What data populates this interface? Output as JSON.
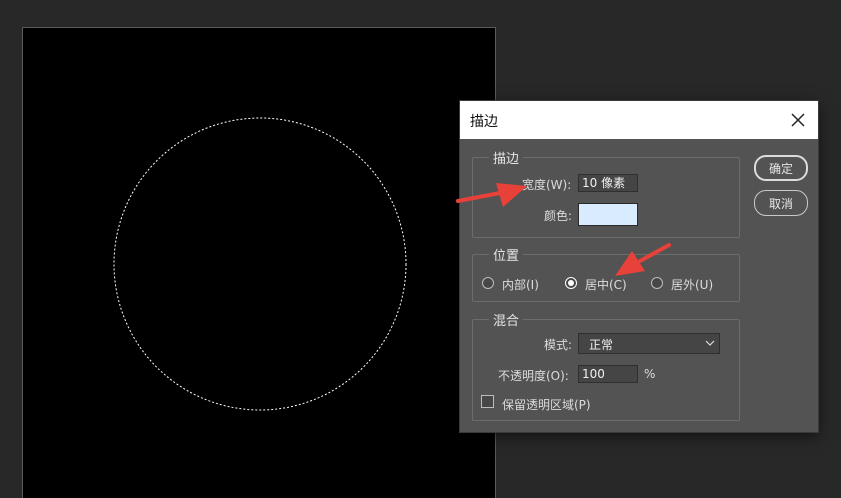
{
  "dialog": {
    "title": "描边",
    "stroke_group": {
      "legend": "描边",
      "width_label": "宽度(W):",
      "width_value": "10 像素",
      "color_label": "颜色:",
      "color_value": "#d8ebff"
    },
    "position_group": {
      "legend": "位置",
      "options": [
        {
          "label": "内部(I)",
          "selected": false
        },
        {
          "label": "居中(C)",
          "selected": true
        },
        {
          "label": "居外(U)",
          "selected": false
        }
      ]
    },
    "blend_group": {
      "legend": "混合",
      "mode_label": "模式:",
      "mode_value": "正常",
      "opacity_label": "不透明度(O):",
      "opacity_value": "100",
      "opacity_unit": "%",
      "preserve_label": "保留透明区域(P)",
      "preserve_checked": false
    },
    "buttons": {
      "ok": "确定",
      "cancel": "取消"
    }
  },
  "colors": {
    "app_bg": "#282828",
    "dialog_bg": "#535353",
    "annotation_arrow": "#e8413a"
  },
  "icons": [
    "close-icon",
    "chevron-down-icon",
    "selection-marquee",
    "annotation-arrow"
  ]
}
